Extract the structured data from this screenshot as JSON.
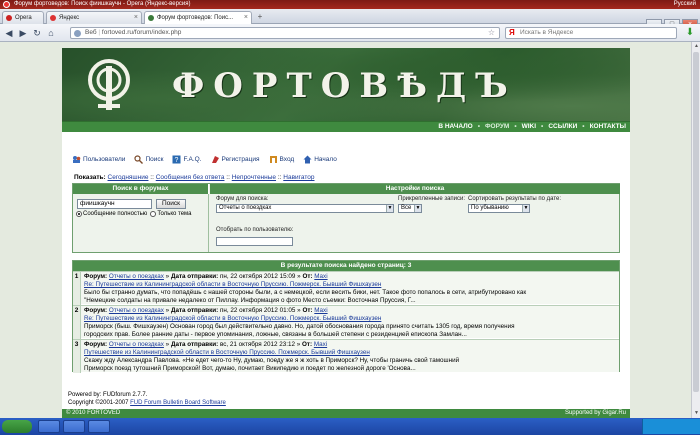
{
  "window": {
    "title": "Форум фортоведов: Поиск фиишкаучн - Opera (Яндекс-версия)",
    "status_right": [
      "Русский"
    ]
  },
  "tabs": [
    {
      "label": "Opera",
      "icon_color": "#cc2222",
      "active": false
    },
    {
      "label": "Яндекс",
      "icon_color": "#dd3333",
      "active": false
    },
    {
      "label": "Форум фортоведов: Поис...",
      "icon_color": "#3a7a3a",
      "active": true
    }
  ],
  "nav": {
    "url_prefix": "Веб",
    "url": "fortoved.ru/forum/index.php",
    "search_placeholder": "Искать в Яндексе"
  },
  "site": {
    "banner_title": "ФОРТОВѢДЪ",
    "topnav": [
      "В НАЧАЛО",
      "ФОРУМ",
      "WIKI",
      "ССЫЛКИ",
      "КОНТАКТЫ"
    ],
    "colors": {
      "green": "#3f8a3f",
      "header": "#4e8f4e",
      "link": "#1a3a9a"
    }
  },
  "toolbar": [
    {
      "label": "Пользователи",
      "icon": "users-icon",
      "color": "#3a6ec0"
    },
    {
      "label": "Поиск",
      "icon": "search-icon",
      "color": "#7a4a2a"
    },
    {
      "label": "F.A.Q.",
      "icon": "help-icon",
      "color": "#2a6ab0"
    },
    {
      "label": "Регистрация",
      "icon": "register-icon",
      "color": "#c03030"
    },
    {
      "label": "Вход",
      "icon": "login-icon",
      "color": "#d08a20"
    },
    {
      "label": "Начало",
      "icon": "home-icon",
      "color": "#3060b0"
    }
  ],
  "showline": {
    "label": "Показать:",
    "links": [
      "Сегодняшние",
      "Сообщения без ответа",
      "Непрочтенные",
      "Навигатор"
    ],
    "sep": "::"
  },
  "search": {
    "left_header": "Поиск в форумах",
    "right_header": "Настройки поиска",
    "query": "фиишкаучн",
    "button": "Поиск",
    "radio_all": "Сообщение полностью",
    "radio_subject": "Только тема",
    "forum_label": "Форум для поиска:",
    "forum_value": "Отчеты о поездках",
    "attach_label": "Прикрепленные записи:",
    "attach_value": "Все",
    "sort_label": "Сортировать результаты по дате:",
    "sort_value": "По убыванию",
    "user_label": "Отобрать по пользователю:"
  },
  "results": {
    "header": "В результате поиска найдено страниц: 3",
    "forum_label": "Форум:",
    "date_label": "Дата отправки:",
    "from_label": "От:",
    "items": [
      {
        "num": "1",
        "forum": "Отчеты о поездках",
        "date": "пн, 22 октября 2012 15:09",
        "author": "Maxi",
        "topic": "Re: Путешествие из Калининградской области в Восточную Пруссию. Пожмерск. Бывший Фишхаузен",
        "snippet1": "Было бы странно думать, что попадёшь с нашей стороны были, а с немецкой, если весить бики, нет. Такое фото попалось в сети, атрибутировано как",
        "snippet2": "\"Немецкие солдаты на привале недалеко от Пиллау. Информация о фото Место съемки: Восточная Пруссия, Г..."
      },
      {
        "num": "2",
        "forum": "Отчеты о поездках",
        "date": "пн, 22 октября 2012 01:05",
        "author": "Maxi",
        "topic": "Re: Путешествие из Калининградской области в Восточную Пруссию. Пожмерск. Бывший Фишхаузен",
        "snippet1": "Приморск (быш. Фишхаузен) Основан город был действительно давно. Но, датой обоснования города принято считать 1305 год, время получения",
        "snippet2": "городских прав. Более ранние даты - первое упоминания, ложные, связаны в большей степени с резиденцией епископа Замлан..."
      },
      {
        "num": "3",
        "forum": "Отчеты о поездках",
        "date": "вс, 21 октября 2012 23:12",
        "author": "Maxi",
        "topic": "Путешествие из Калининградской области в Восточную Пруссию. Пожмерск. Бывший Фишхаузен",
        "snippet1": "Скажу жду Александра Павлова. «Не едет чего-то Ну, думаю, поеду же я ж хоть в Приморск? Ну, чтобы граничь свой тамошний",
        "snippet2": "Приморск поезд тутошний Приморской! Вот, думаю, почитает Википедию и поедет по железной дороге 'Основа..."
      }
    ]
  },
  "powered": {
    "line1": "Powered by: FUDforum 2.7.7.",
    "line2_prefix": "Copyright ©2001-2007",
    "line2_link": "FUD Forum Bulletin Board Software"
  },
  "footer": {
    "left": "© 2010 FORTOVED",
    "right": "Supported by Gigar.Ru"
  }
}
